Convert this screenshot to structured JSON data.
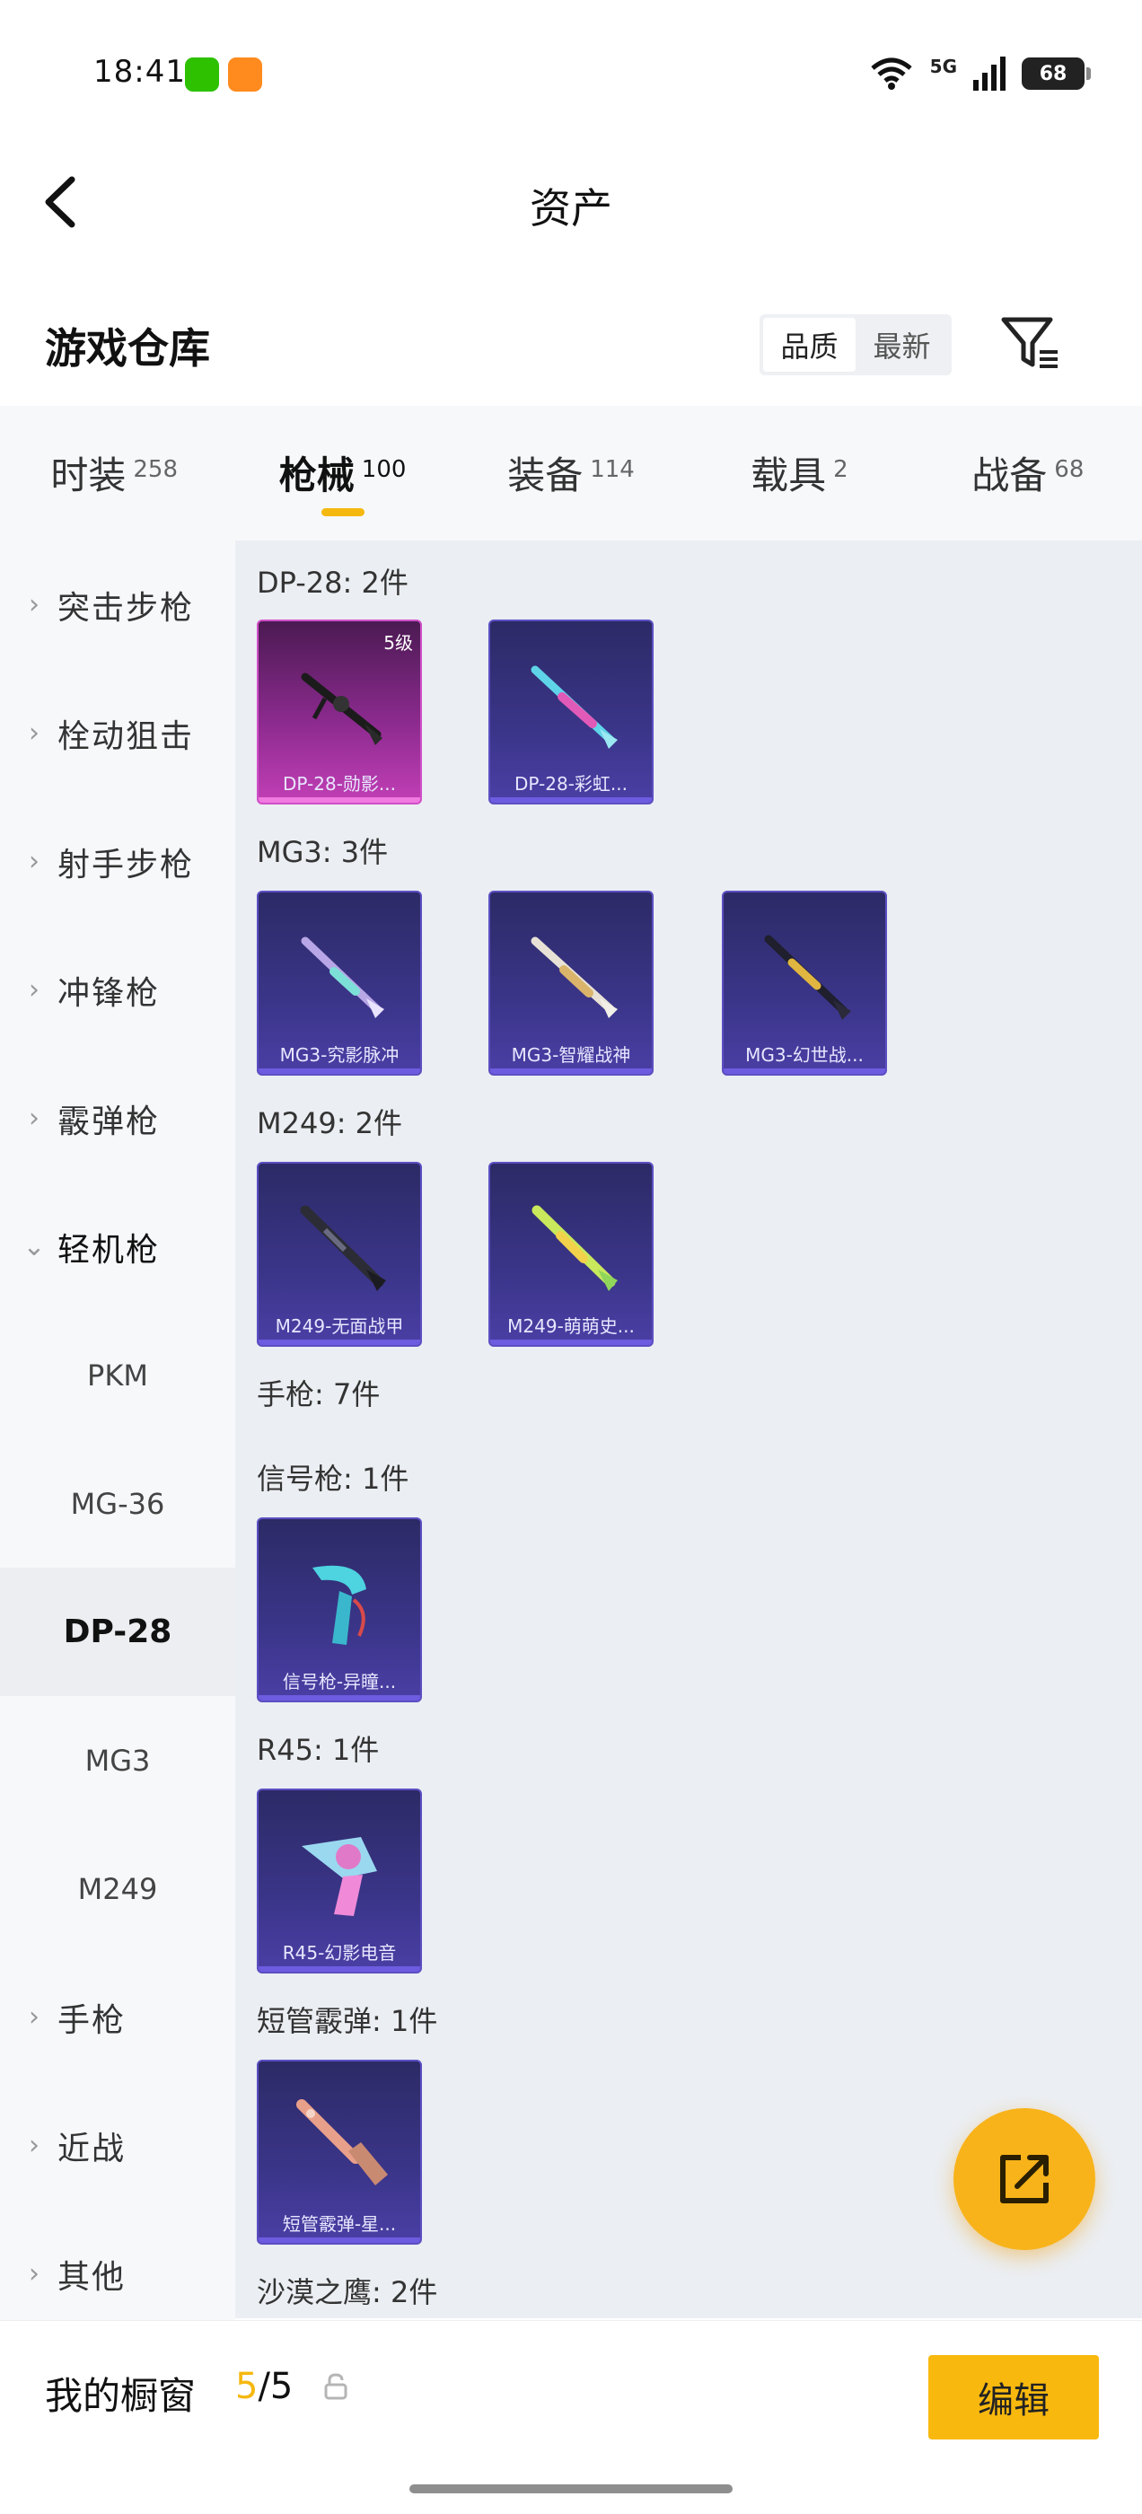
{
  "status": {
    "time": "18:41",
    "network": "5G",
    "battery": "68"
  },
  "header": {
    "title": "资产"
  },
  "section": {
    "title": "游戏仓库",
    "sort_options": [
      "品质",
      "最新"
    ],
    "sort_active": 0
  },
  "tabs": [
    {
      "label": "时装",
      "count": "258"
    },
    {
      "label": "枪械",
      "count": "100",
      "active": true
    },
    {
      "label": "装备",
      "count": "114"
    },
    {
      "label": "载具",
      "count": "2"
    },
    {
      "label": "战备",
      "count": "68"
    }
  ],
  "sidebar": {
    "categories": [
      "突击步枪",
      "栓动狙击",
      "射手步枪",
      "冲锋枪",
      "霰弹枪",
      "轻机枪"
    ],
    "subitems": [
      "PKM",
      "MG-36",
      "DP-28",
      "MG3",
      "M249"
    ],
    "active_sub": "DP-28",
    "more": [
      "手枪",
      "近战",
      "其他"
    ]
  },
  "groups": [
    {
      "title": "DP-28: 2件",
      "items": [
        {
          "name": "DP-28-勋影...",
          "level": "5级",
          "rare": true
        },
        {
          "name": "DP-28-彩虹..."
        }
      ]
    },
    {
      "title": "MG3: 3件",
      "items": [
        {
          "name": "MG3-究影脉冲"
        },
        {
          "name": "MG3-智耀战神"
        },
        {
          "name": "MG3-幻世战..."
        }
      ]
    },
    {
      "title": "M249: 2件",
      "items": [
        {
          "name": "M249-无面战甲"
        },
        {
          "name": "M249-萌萌史..."
        }
      ]
    },
    {
      "title": "手枪: 7件",
      "items": []
    },
    {
      "title": "信号枪: 1件",
      "items": [
        {
          "name": "信号枪-异瞳..."
        }
      ]
    },
    {
      "title": "R45: 1件",
      "items": [
        {
          "name": "R45-幻影电音"
        }
      ]
    },
    {
      "title": "短管霰弹: 1件",
      "items": [
        {
          "name": "短管霰弹-星..."
        }
      ]
    },
    {
      "title": "沙漠之鹰: 2件",
      "items": []
    }
  ],
  "bottom": {
    "showcase_label": "我的橱窗",
    "used": "5",
    "total": "/5",
    "edit_label": "编辑"
  },
  "colors": {
    "accent": "#f8b80e",
    "card": "#3b3589",
    "rare": "#c23fb6"
  }
}
